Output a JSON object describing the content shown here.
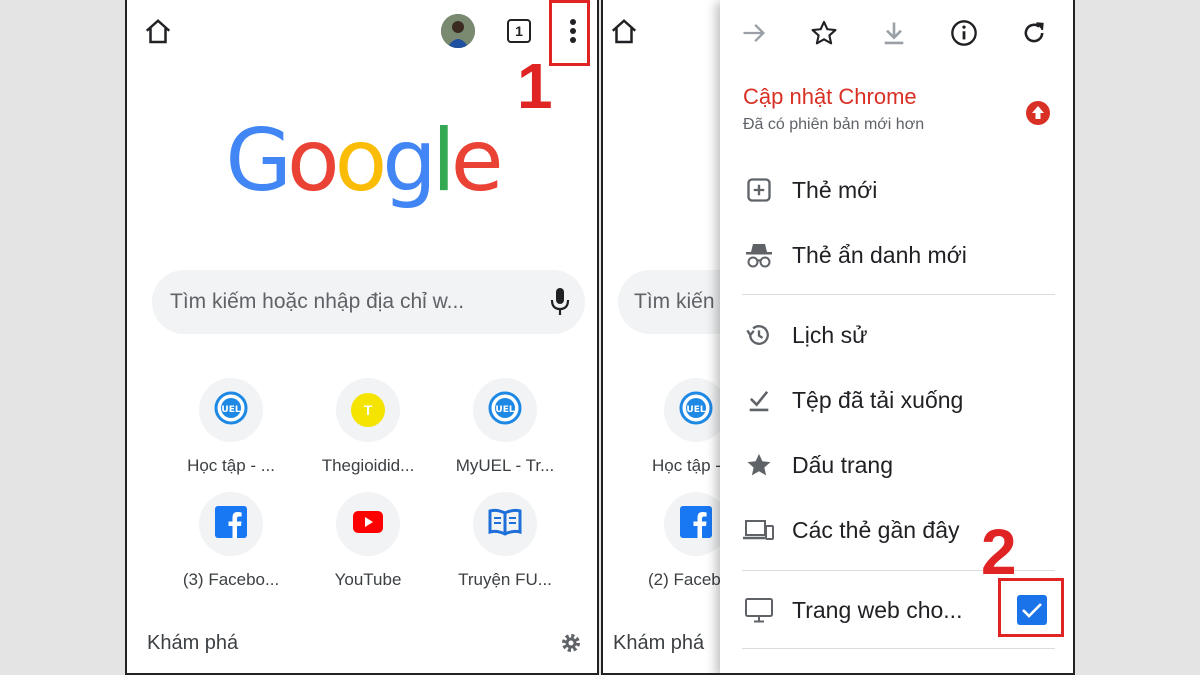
{
  "left": {
    "tab_count": "1",
    "search_placeholder": "Tìm kiếm hoặc nhập địa chỉ w...",
    "tiles": [
      {
        "label": "Học tập - ...",
        "icon": "uel-logo-icon"
      },
      {
        "label": "Thegioidid...",
        "icon": "letter-t-icon",
        "letter": "T"
      },
      {
        "label": "MyUEL - Tr...",
        "icon": "uel-logo-icon"
      },
      {
        "label": "(3) Facebo...",
        "icon": "facebook-icon"
      },
      {
        "label": "YouTube",
        "icon": "youtube-icon"
      },
      {
        "label": "Truyện FU...",
        "icon": "book-icon"
      }
    ],
    "discover_label": "Khám phá",
    "step_number": "1"
  },
  "right": {
    "search_partial": "Tìm kiến",
    "tile_labels": [
      "Học tập -",
      "(2) Faceb"
    ],
    "discover_label": "Khám phá",
    "menu": {
      "toolbar_icons": [
        "forward-arrow-icon",
        "star-icon",
        "download-icon",
        "info-icon",
        "refresh-icon"
      ],
      "update_title": "Cập nhật Chrome",
      "update_subtitle": "Đã có phiên bản mới hơn",
      "items": [
        {
          "label": "Thẻ mới",
          "icon": "new-tab-icon"
        },
        {
          "label": "Thẻ ẩn danh mới",
          "icon": "incognito-icon"
        },
        {
          "label": "Lịch sử",
          "icon": "history-icon"
        },
        {
          "label": "Tệp đã tải xuống",
          "icon": "downloads-icon"
        },
        {
          "label": "Dấu trang",
          "icon": "bookmark-star-icon"
        },
        {
          "label": "Các thẻ gần đây",
          "icon": "recent-tabs-icon"
        },
        {
          "label": "Trang web cho...",
          "icon": "desktop-site-icon",
          "checked": true
        }
      ]
    },
    "step_number": "2"
  },
  "colors": {
    "google_blue": "#4285f4",
    "google_red": "#ea4335",
    "google_yellow": "#fbbc05",
    "google_green": "#34a853",
    "marker_red": "#e02424",
    "checkbox_blue": "#1a73e8"
  }
}
